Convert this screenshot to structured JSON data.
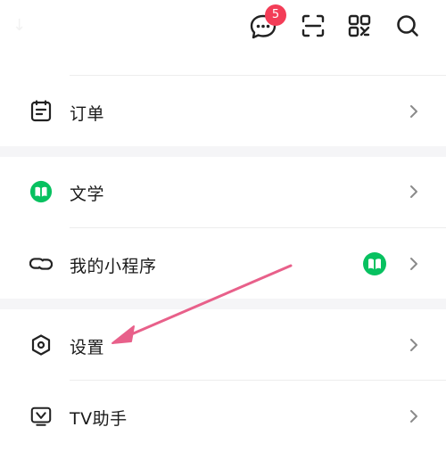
{
  "topbar": {
    "left_glyph": "↓",
    "messages_badge": "5",
    "icons": [
      "message-icon",
      "scan-icon",
      "qr-code-icon",
      "search-icon"
    ]
  },
  "menu": {
    "orders": {
      "label": "订单",
      "icon": "order-icon"
    },
    "literature": {
      "label": "文学",
      "icon": "book-icon",
      "accent": "#07c160"
    },
    "mini_programs": {
      "label": "我的小程序",
      "icon": "mini-program-icon",
      "badge_icon": "book-icon"
    },
    "settings": {
      "label": "设置",
      "icon": "hexagon-settings-icon"
    },
    "tv_assistant": {
      "label": "TV助手",
      "icon": "tv-icon"
    }
  },
  "colors": {
    "accent_green": "#07c160",
    "badge_red": "#f33d57",
    "annotation_pink": "#e8608a",
    "separator": "#f5f5f7"
  }
}
